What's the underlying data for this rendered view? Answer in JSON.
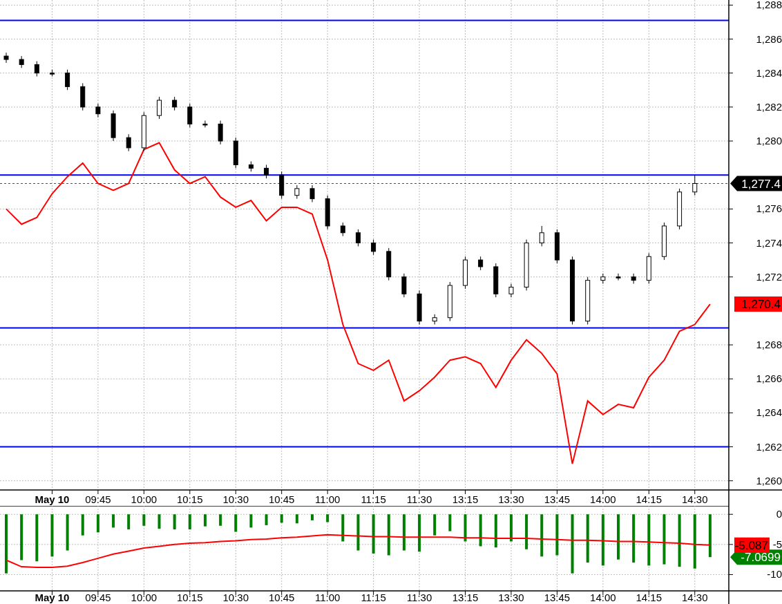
{
  "price_chart": {
    "chart_data": {
      "type": "candlestick",
      "categories": [
        null,
        null,
        null,
        "May 10",
        null,
        null,
        "09:45",
        null,
        null,
        "10:00",
        null,
        null,
        "10:15",
        null,
        null,
        "10:30",
        null,
        null,
        "10:45",
        null,
        null,
        "11:00",
        null,
        null,
        "11:15",
        null,
        null,
        "11:30",
        null,
        null,
        "13:15",
        null,
        null,
        "13:30",
        null,
        null,
        "13:45",
        null,
        null,
        "14:00",
        null,
        null,
        "14:15",
        null,
        null,
        "14:30",
        null
      ],
      "ohlc": [
        [
          1285.0,
          1285.2,
          1284.6,
          1284.8
        ],
        [
          1284.8,
          1285.0,
          1284.3,
          1284.5
        ],
        [
          1284.5,
          1284.7,
          1283.8,
          1284.0
        ],
        [
          1284.0,
          1284.2,
          1283.8,
          1284.0
        ],
        [
          1284.0,
          1284.2,
          1283.0,
          1283.2
        ],
        [
          1283.2,
          1283.4,
          1281.8,
          1282.0
        ],
        [
          1282.0,
          1282.2,
          1281.4,
          1281.6
        ],
        [
          1281.6,
          1281.8,
          1280.0,
          1280.2
        ],
        [
          1280.2,
          1280.4,
          1279.4,
          1279.6
        ],
        [
          1279.6,
          1281.7,
          1279.4,
          1281.5
        ],
        [
          1281.5,
          1282.6,
          1281.3,
          1282.4
        ],
        [
          1282.4,
          1282.6,
          1281.8,
          1282.0
        ],
        [
          1282.0,
          1282.2,
          1280.8,
          1281.0
        ],
        [
          1281.0,
          1281.2,
          1280.8,
          1281.0
        ],
        [
          1281.0,
          1281.2,
          1279.8,
          1280.0
        ],
        [
          1280.0,
          1280.2,
          1278.4,
          1278.6
        ],
        [
          1278.6,
          1278.8,
          1278.2,
          1278.4
        ],
        [
          1278.4,
          1278.6,
          1277.8,
          1278.0
        ],
        [
          1278.0,
          1278.2,
          1276.6,
          1276.8
        ],
        [
          1276.8,
          1277.4,
          1276.6,
          1277.2
        ],
        [
          1277.2,
          1277.4,
          1276.4,
          1276.6
        ],
        [
          1276.6,
          1276.8,
          1274.8,
          1275.0
        ],
        [
          1275.0,
          1275.2,
          1274.4,
          1274.6
        ],
        [
          1274.6,
          1274.8,
          1273.8,
          1274.0
        ],
        [
          1274.0,
          1274.2,
          1273.3,
          1273.5
        ],
        [
          1273.5,
          1273.7,
          1271.8,
          1272.0
        ],
        [
          1272.0,
          1272.2,
          1270.8,
          1271.0
        ],
        [
          1271.0,
          1271.2,
          1269.2,
          1269.4
        ],
        [
          1269.4,
          1269.8,
          1269.2,
          1269.6
        ],
        [
          1269.6,
          1271.7,
          1269.4,
          1271.5
        ],
        [
          1271.5,
          1273.2,
          1271.3,
          1273.0
        ],
        [
          1273.0,
          1273.2,
          1272.4,
          1272.6
        ],
        [
          1272.6,
          1272.8,
          1270.8,
          1271.0
        ],
        [
          1271.0,
          1271.6,
          1270.8,
          1271.4
        ],
        [
          1271.4,
          1274.2,
          1271.2,
          1274.0
        ],
        [
          1274.0,
          1275.0,
          1273.8,
          1274.6
        ],
        [
          1274.6,
          1274.8,
          1272.8,
          1273.0
        ],
        [
          1273.0,
          1273.2,
          1269.2,
          1269.4
        ],
        [
          1269.4,
          1272.0,
          1269.2,
          1271.8
        ],
        [
          1271.8,
          1272.2,
          1271.6,
          1272.0
        ],
        [
          1272.0,
          1272.2,
          1271.8,
          1272.0
        ],
        [
          1272.0,
          1272.2,
          1271.6,
          1271.8
        ],
        [
          1271.8,
          1273.4,
          1271.6,
          1273.2
        ],
        [
          1273.2,
          1275.2,
          1273.0,
          1275.0
        ],
        [
          1275.0,
          1277.2,
          1274.8,
          1277.0
        ],
        [
          1277.0,
          1278.0,
          1276.8,
          1277.5
        ],
        null
      ],
      "series": [
        {
          "type": "line",
          "color": "#ff0000",
          "values": [
            1276.0,
            1275.1,
            1275.5,
            1276.9,
            1277.9,
            1278.7,
            1277.5,
            1277.1,
            1277.5,
            1279.5,
            1279.9,
            1278.3,
            1277.5,
            1277.9,
            1276.7,
            1276.1,
            1276.5,
            1275.3,
            1276.1,
            1276.1,
            1275.7,
            1273.0,
            1269.2,
            1266.9,
            1266.5,
            1267.1,
            1264.7,
            1265.3,
            1266.1,
            1267.1,
            1267.3,
            1266.9,
            1265.5,
            1267.1,
            1268.3,
            1267.5,
            1266.3,
            1261.0,
            1264.7,
            1263.9,
            1264.5,
            1264.3,
            1266.1,
            1267.1,
            1268.8,
            1269.2,
            1270.4
          ]
        }
      ],
      "ylim": [
        1259.5,
        1288.3
      ],
      "yticks": [
        {
          "value": 1288,
          "label": "1,288"
        },
        {
          "value": 1286,
          "label": "1,286"
        },
        {
          "value": 1284,
          "label": "1,284"
        },
        {
          "value": 1282,
          "label": "1,282"
        },
        {
          "value": 1280,
          "label": "1,280"
        },
        {
          "value": 1276,
          "label": "1,276"
        },
        {
          "value": 1274,
          "label": "1,274"
        },
        {
          "value": 1272,
          "label": "1,272"
        },
        {
          "value": 1268,
          "label": "1,268"
        },
        {
          "value": 1266,
          "label": "1,266"
        },
        {
          "value": 1264,
          "label": "1,264"
        },
        {
          "value": 1262,
          "label": "1,262"
        },
        {
          "value": 1260,
          "label": "1,260"
        }
      ],
      "grid": true,
      "ref_lines": [
        {
          "axis": "y",
          "value": 1287.1,
          "color": "#0000ff"
        },
        {
          "axis": "y",
          "value": 1278.0,
          "color": "#0000ff"
        },
        {
          "axis": "y",
          "value": 1277.5,
          "color": "#ff0000"
        },
        {
          "axis": "y",
          "value": 1269.0,
          "color": "#0000ff"
        },
        {
          "axis": "y",
          "value": 1262.0,
          "color": "#0000ff"
        }
      ]
    },
    "last_value_labels": [
      {
        "text": "1,277.4",
        "kind": "arrow",
        "color": "#000000"
      },
      {
        "text": "1,270.4",
        "kind": "box",
        "color": "#ff0000"
      }
    ]
  },
  "indicator_chart": {
    "chart_data": {
      "type": "bar",
      "categories": [
        null,
        null,
        null,
        "May 10",
        null,
        null,
        "09:45",
        null,
        null,
        "10:00",
        null,
        null,
        "10:15",
        null,
        null,
        "10:30",
        null,
        null,
        "10:45",
        null,
        null,
        "11:00",
        null,
        null,
        "11:15",
        null,
        null,
        "11:30",
        null,
        null,
        "13:15",
        null,
        null,
        "13:30",
        null,
        null,
        "13:45",
        null,
        null,
        "14:00",
        null,
        null,
        "14:15",
        null,
        null,
        "14:30",
        null
      ],
      "series": [
        {
          "color": "#008000",
          "values": [
            -9.8,
            -7.6,
            -7.8,
            -7.0,
            -6.0,
            -3.5,
            -3.0,
            -2.2,
            -2.5,
            -1.9,
            -2.4,
            -2.5,
            -2.5,
            -2.0,
            -1.9,
            -2.9,
            -2.2,
            -1.8,
            -1.4,
            -1.5,
            -1.0,
            -1.3,
            -4.5,
            -6.0,
            -6.5,
            -6.8,
            -6.0,
            -6.2,
            -3.5,
            -2.8,
            -4.5,
            -5.3,
            -5.5,
            -4.5,
            -5.8,
            -7.0,
            -6.8,
            -9.8,
            -8.0,
            -8.5,
            -7.5,
            -8.0,
            -8.5,
            -8.3,
            -8.7,
            -9.0,
            -7.1
          ]
        },
        {
          "type": "line",
          "color": "#ff0000",
          "values": [
            -7.6,
            -8.7,
            -8.8,
            -8.8,
            -8.6,
            -8.0,
            -7.3,
            -6.6,
            -6.1,
            -5.6,
            -5.3,
            -5.0,
            -4.8,
            -4.7,
            -4.5,
            -4.4,
            -4.2,
            -4.1,
            -3.9,
            -3.8,
            -3.6,
            -3.4,
            -3.5,
            -3.6,
            -3.7,
            -3.7,
            -3.8,
            -3.8,
            -3.8,
            -3.8,
            -3.9,
            -3.9,
            -4.0,
            -4.0,
            -4.0,
            -4.1,
            -4.2,
            -4.3,
            -4.3,
            -4.4,
            -4.5,
            -4.5,
            -4.6,
            -4.7,
            -4.8,
            -5.0,
            -5.1
          ]
        }
      ],
      "ylim": [
        -12.7,
        1.4
      ],
      "grid": true,
      "yticks": [
        {
          "value": 0,
          "label": "0"
        },
        {
          "value": -5,
          "label": "-5"
        },
        {
          "value": -10,
          "label": "-10"
        }
      ]
    },
    "last_value_labels": [
      {
        "text": "-7.0699",
        "kind": "arrow",
        "color": "#008000"
      },
      {
        "text": "-5.087",
        "kind": "box",
        "color": "#ff0000"
      }
    ]
  }
}
